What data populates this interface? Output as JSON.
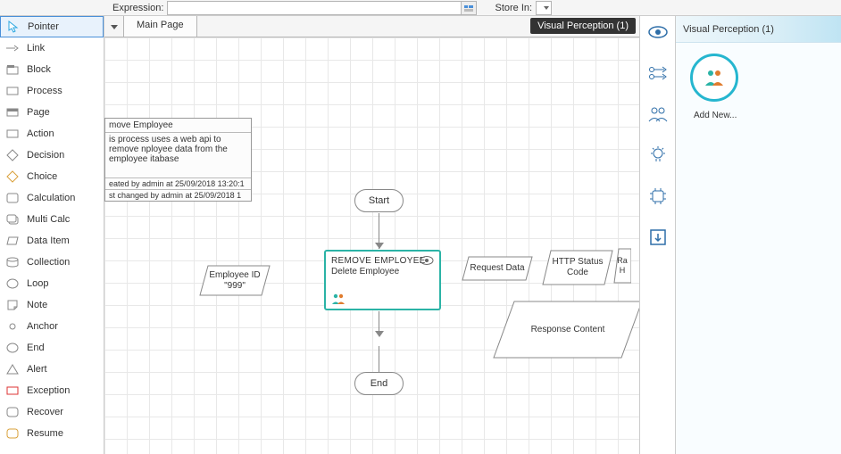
{
  "exprbar": {
    "expr_label": "Expression:",
    "expr_value": "",
    "store_label": "Store In:"
  },
  "tabs": {
    "main": "Main Page",
    "vp_badge": "Visual Perception (1)"
  },
  "toolbox": [
    {
      "name": "pointer",
      "label": "Pointer",
      "selected": true
    },
    {
      "name": "link",
      "label": "Link"
    },
    {
      "name": "block",
      "label": "Block"
    },
    {
      "name": "process",
      "label": "Process"
    },
    {
      "name": "page",
      "label": "Page"
    },
    {
      "name": "action",
      "label": "Action"
    },
    {
      "name": "decision",
      "label": "Decision"
    },
    {
      "name": "choice",
      "label": "Choice"
    },
    {
      "name": "calculation",
      "label": "Calculation"
    },
    {
      "name": "multicalc",
      "label": "Multi Calc"
    },
    {
      "name": "dataitem",
      "label": "Data Item"
    },
    {
      "name": "collection",
      "label": "Collection"
    },
    {
      "name": "loop",
      "label": "Loop"
    },
    {
      "name": "note",
      "label": "Note"
    },
    {
      "name": "anchor",
      "label": "Anchor"
    },
    {
      "name": "end",
      "label": "End"
    },
    {
      "name": "alert",
      "label": "Alert"
    },
    {
      "name": "exception",
      "label": "Exception"
    },
    {
      "name": "recover",
      "label": "Recover"
    },
    {
      "name": "resume",
      "label": "Resume"
    }
  ],
  "infobox": {
    "title": "move Employee",
    "desc": "is process uses a web api to remove nployee data from the employee itabase",
    "created": "eated by admin at 25/09/2018 13:20:1",
    "changed": "st changed by admin at 25/09/2018 1"
  },
  "shapes": {
    "start": "Start",
    "end": "End",
    "action_title": "REMOVE EMPLOYEE",
    "action_sub": "Delete Employee",
    "emp_id_label": "Employee ID",
    "emp_id_val": "\"999\"",
    "request_data": "Request Data",
    "http_status": "HTTP Status Code",
    "extra_r": "Ra H",
    "response": "Response Content"
  },
  "vp_panel": {
    "title": "Visual Perception (1)",
    "add_new": "Add New..."
  }
}
